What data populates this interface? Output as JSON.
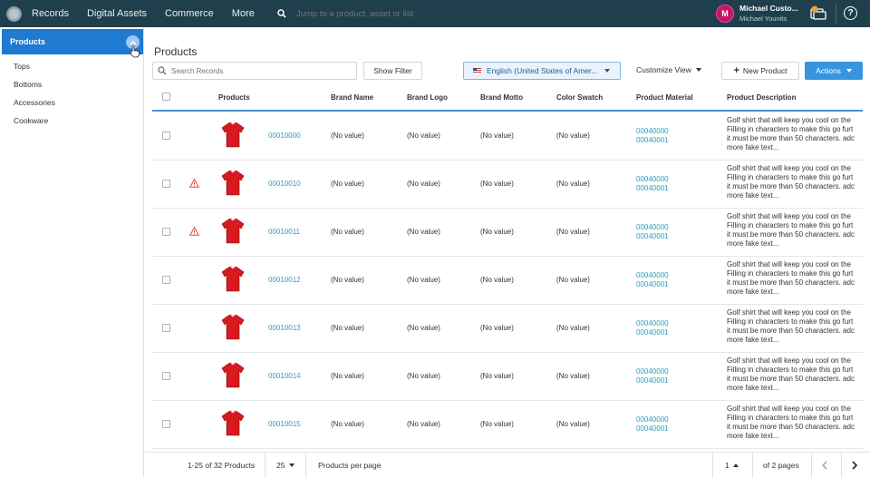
{
  "topbar": {
    "nav": [
      "Records",
      "Digital Assets",
      "Commerce",
      "More"
    ],
    "search_placeholder": "Jump to a product, asset or list",
    "user_initial": "M",
    "user_name": "Michael Custo...",
    "user_sub": "Michael Younits",
    "help": "?"
  },
  "sidebar": {
    "active": "Products",
    "items": [
      "Tops",
      "Bottoms",
      "Accessories",
      "Cookware"
    ]
  },
  "main": {
    "title": "Products",
    "search_placeholder": "Search Records",
    "show_filter": "Show Filter",
    "language": "English (United States of Amer...",
    "customize_view": "Customize View",
    "new_product": "New Product",
    "actions": "Actions"
  },
  "table": {
    "columns": [
      "Products",
      "Brand Name",
      "Brand Logo",
      "Brand Motto",
      "Color Swatch",
      "Product Material",
      "Product Description"
    ],
    "rows": [
      {
        "id": "00010000",
        "warning": false,
        "brand_name": "(No value)",
        "brand_logo": "(No value)",
        "brand_motto": "(No value)",
        "color_swatch": "(No value)",
        "materials": [
          "00040000",
          "00040001"
        ],
        "description": [
          "Golf shirt that will keep you cool on the",
          "Filling in characters to make this go furt",
          "it must be more than 50 characters. adc",
          "more fake text..."
        ]
      },
      {
        "id": "00010010",
        "warning": true,
        "brand_name": "(No value)",
        "brand_logo": "(No value)",
        "brand_motto": "(No value)",
        "color_swatch": "(No value)",
        "materials": [
          "00040000",
          "00040001"
        ],
        "description": [
          "Golf shirt that will keep you cool on the",
          "Filling in characters to make this go furt",
          "it must be more than 50 characters. adc",
          "more fake text..."
        ]
      },
      {
        "id": "00010011",
        "warning": true,
        "brand_name": "(No value)",
        "brand_logo": "(No value)",
        "brand_motto": "(No value)",
        "color_swatch": "(No value)",
        "materials": [
          "00040000",
          "00040001"
        ],
        "description": [
          "Golf shirt that will keep you cool on the",
          "Filling in characters to make this go furt",
          "it must be more than 50 characters. adc",
          "more fake text..."
        ]
      },
      {
        "id": "00010012",
        "warning": false,
        "brand_name": "(No value)",
        "brand_logo": "(No value)",
        "brand_motto": "(No value)",
        "color_swatch": "(No value)",
        "materials": [
          "00040000",
          "00040001"
        ],
        "description": [
          "Golf shirt that will keep you cool on the",
          "Filling in characters to make this go furt",
          "it must be more than 50 characters. adc",
          "more fake text..."
        ]
      },
      {
        "id": "00010013",
        "warning": false,
        "brand_name": "(No value)",
        "brand_logo": "(No value)",
        "brand_motto": "(No value)",
        "color_swatch": "(No value)",
        "materials": [
          "00040000",
          "00040001"
        ],
        "description": [
          "Golf shirt that will keep you cool on the",
          "Filling in characters to make this go furt",
          "it must be more than 50 characters. adc",
          "more fake text..."
        ]
      },
      {
        "id": "00010014",
        "warning": false,
        "brand_name": "(No value)",
        "brand_logo": "(No value)",
        "brand_motto": "(No value)",
        "color_swatch": "(No value)",
        "materials": [
          "00040000",
          "00040001"
        ],
        "description": [
          "Golf shirt that will keep you cool on the",
          "Filling in characters to make this go furt",
          "it must be more than 50 characters. adc",
          "more fake text..."
        ]
      },
      {
        "id": "00010015",
        "warning": false,
        "brand_name": "(No value)",
        "brand_logo": "(No value)",
        "brand_motto": "(No value)",
        "color_swatch": "(No value)",
        "materials": [
          "00040000",
          "00040001"
        ],
        "description": [
          "Golf shirt that will keep you cool on the",
          "Filling in characters to make this go furt",
          "it must be more than 50 characters. adc",
          "more fake text..."
        ]
      }
    ]
  },
  "footer": {
    "range": "1-25 of 32 Products",
    "per_page_value": "25",
    "per_page_label": "Products per page",
    "page": "1",
    "of_pages": "of 2 pages"
  },
  "colors": {
    "topbar": "#1f3f4c",
    "accent": "#1f7ad1",
    "link": "#2aa0c8",
    "shirt": "#d71920",
    "warning": "#e04b3c"
  }
}
